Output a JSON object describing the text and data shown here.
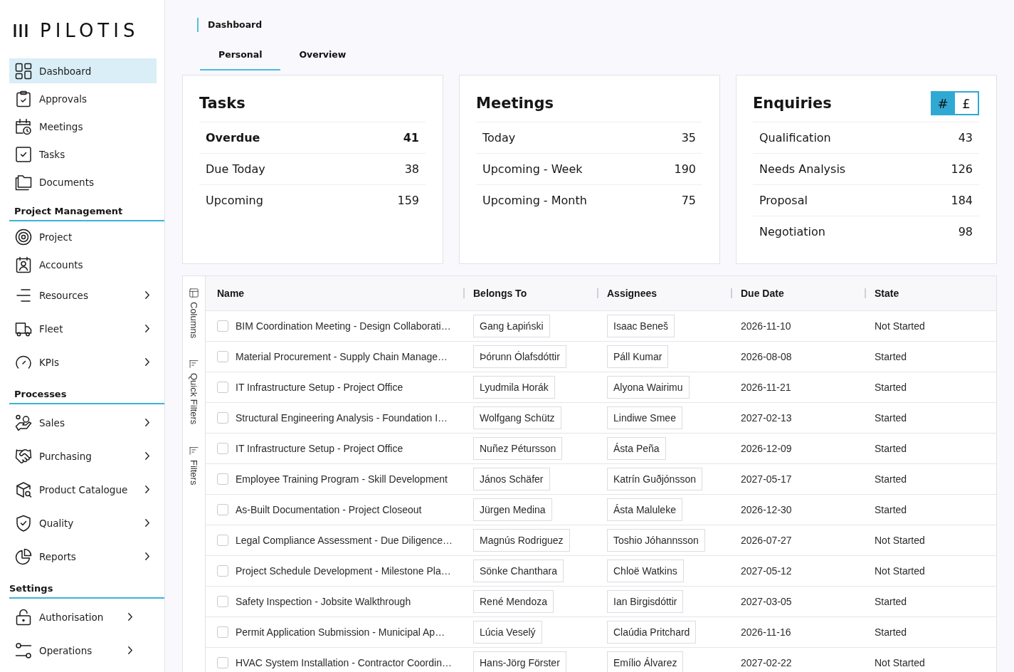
{
  "sidebar": {
    "logo": "PILOTIS",
    "sections": [
      {
        "items": [
          {
            "label": "Dashboard",
            "selected": true,
            "has_submenu": false
          },
          {
            "label": "Approvals",
            "selected": false,
            "has_submenu": false
          },
          {
            "label": "Meetings",
            "selected": false,
            "has_submenu": false
          },
          {
            "label": "Tasks",
            "selected": false,
            "has_submenu": false
          },
          {
            "label": "Documents",
            "selected": false,
            "has_submenu": false
          }
        ]
      },
      {
        "heading": "Project Management",
        "items": [
          {
            "label": "Project",
            "selected": false,
            "has_submenu": false
          },
          {
            "label": "Accounts",
            "selected": false,
            "has_submenu": false
          },
          {
            "label": "Resources",
            "selected": false,
            "has_submenu": true
          },
          {
            "label": "Fleet",
            "selected": false,
            "has_submenu": true
          },
          {
            "label": "KPIs",
            "selected": false,
            "has_submenu": true
          }
        ]
      },
      {
        "heading": "Processes",
        "items": [
          {
            "label": "Sales",
            "selected": false,
            "has_submenu": true
          },
          {
            "label": "Purchasing",
            "selected": false,
            "has_submenu": true
          },
          {
            "label": "Product Catalogue",
            "selected": false,
            "has_submenu": true
          },
          {
            "label": "Quality",
            "selected": false,
            "has_submenu": true
          },
          {
            "label": "Reports",
            "selected": false,
            "has_submenu": true
          }
        ]
      },
      {
        "heading": "Settings",
        "items": [
          {
            "label": "Authorisation",
            "selected": false,
            "has_submenu": true
          },
          {
            "label": "Operations",
            "selected": false,
            "has_submenu": true
          }
        ]
      }
    ]
  },
  "breadcrumb": "Dashboard",
  "tabs": [
    {
      "label": "Personal",
      "selected": true
    },
    {
      "label": "Overview",
      "selected": false
    }
  ],
  "cards": [
    {
      "title": "Tasks",
      "rows": [
        {
          "label": "Overdue",
          "value": "41",
          "emphasized": true
        },
        {
          "label": "Due Today",
          "value": "38",
          "emphasized": false
        },
        {
          "label": "Upcoming",
          "value": "159",
          "emphasized": false
        }
      ]
    },
    {
      "title": "Meetings",
      "rows": [
        {
          "label": "Today",
          "value": "35",
          "emphasized": false
        },
        {
          "label": "Upcoming - Week",
          "value": "190",
          "emphasized": false
        },
        {
          "label": "Upcoming - Month",
          "value": "75",
          "emphasized": false
        }
      ]
    },
    {
      "title": "Enquiries",
      "toggle": [
        {
          "label": "#",
          "selected": true
        },
        {
          "label": "£",
          "selected": false
        }
      ],
      "rows": [
        {
          "label": "Qualification",
          "value": "43",
          "emphasized": false
        },
        {
          "label": "Needs Analysis",
          "value": "126",
          "emphasized": false
        },
        {
          "label": "Proposal",
          "value": "184",
          "emphasized": false
        },
        {
          "label": "Negotiation",
          "value": "98",
          "emphasized": false
        }
      ]
    }
  ],
  "table": {
    "side_panel": [
      "Columns",
      "Quick Filters",
      "Filters"
    ],
    "columns": [
      "Name",
      "Belongs To",
      "Assignees",
      "Due Date",
      "State"
    ],
    "rows": [
      {
        "checked": false,
        "name": "BIM Coordination Meeting - Design Collaborati…",
        "belongs_to": "Gang Łapiński",
        "assignees": "Isaac Beneš",
        "due_date": "2026-11-10",
        "state": "Not Started"
      },
      {
        "checked": false,
        "name": "Material Procurement - Supply Chain Manage…",
        "belongs_to": "Þórunn Ólafsdóttir",
        "assignees": "Páll Kumar",
        "due_date": "2026-08-08",
        "state": "Started"
      },
      {
        "checked": false,
        "name": "IT Infrastructure Setup - Project Office",
        "belongs_to": "Lyudmila Horák",
        "assignees": "Alyona Wairimu",
        "due_date": "2026-11-21",
        "state": "Started"
      },
      {
        "checked": false,
        "name": "Structural Engineering Analysis - Foundation I…",
        "belongs_to": "Wolfgang Schütz",
        "assignees": "Lindiwe Smee",
        "due_date": "2027-02-13",
        "state": "Started"
      },
      {
        "checked": false,
        "name": "IT Infrastructure Setup - Project Office",
        "belongs_to": "Nuñez Pétursson",
        "assignees": "Ásta Peña",
        "due_date": "2026-12-09",
        "state": "Started"
      },
      {
        "checked": false,
        "name": "Employee Training Program - Skill Development",
        "belongs_to": "János Schäfer",
        "assignees": "Katrín Guðjónsson",
        "due_date": "2027-05-17",
        "state": "Started"
      },
      {
        "checked": false,
        "name": "As-Built Documentation - Project Closeout",
        "belongs_to": "Jürgen Medina",
        "assignees": "Ásta Maluleke",
        "due_date": "2026-12-30",
        "state": "Started"
      },
      {
        "checked": false,
        "name": "Legal Compliance Assessment - Due Diligence…",
        "belongs_to": "Magnús Rodriguez",
        "assignees": "Toshio Jóhannsson",
        "due_date": "2026-07-27",
        "state": "Not Started"
      },
      {
        "checked": false,
        "name": "Project Schedule Development - Milestone Pla…",
        "belongs_to": "Sönke Chanthara",
        "assignees": "Chloë Watkins",
        "due_date": "2027-05-12",
        "state": "Not Started"
      },
      {
        "checked": false,
        "name": "Safety Inspection - Jobsite Walkthrough",
        "belongs_to": "René Mendoza",
        "assignees": "Ian Birgisdóttir",
        "due_date": "2027-03-05",
        "state": "Started"
      },
      {
        "checked": false,
        "name": "Permit Application Submission - Municipal Ap…",
        "belongs_to": "Lúcia Veselý",
        "assignees": "Claúdia Pritchard",
        "due_date": "2026-11-16",
        "state": "Started"
      },
      {
        "checked": false,
        "name": "HVAC System Installation - Contractor Coordin…",
        "belongs_to": "Hans-Jörg Förster",
        "assignees": "Emílio Álvarez",
        "due_date": "2027-02-22",
        "state": "Not Started"
      }
    ]
  }
}
